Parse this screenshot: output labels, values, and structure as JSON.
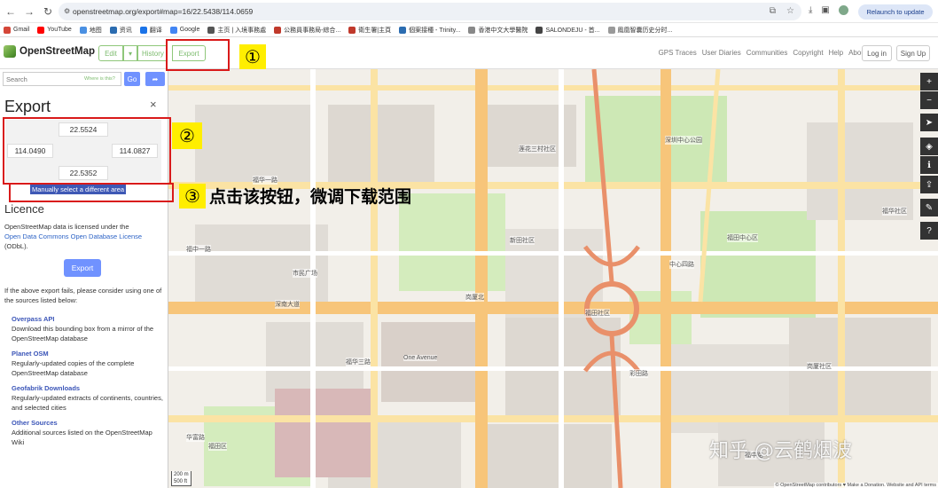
{
  "browser": {
    "url": "openstreetmap.org/export#map=16/22.5438/114.0659",
    "relaunch_label": "Relaunch to update",
    "bookmarks": [
      "Gmail",
      "YouTube",
      "地图",
      "资讯",
      "翻译",
      "Google",
      "主页 | 入境事務處",
      "公務員事務局-綜合...",
      "衛生署|主頁",
      "個案接種 - Trinity...",
      "香港中文大學醫院",
      "SALONDEJU - 首...",
      "鳳凰智囊历史分时..."
    ]
  },
  "osm": {
    "logo_text": "OpenStreetMap",
    "edit_label": "Edit",
    "edit_dropdown": "▾",
    "history_label": "History",
    "export_label": "Export",
    "nav_links": [
      "GPS Traces",
      "User Diaries",
      "Communities",
      "Copyright",
      "Help",
      "About"
    ],
    "login_label": "Log in",
    "signup_label": "Sign Up"
  },
  "search": {
    "placeholder": "Search",
    "where_is_this": "Where is this?",
    "go_label": "Go"
  },
  "export_panel": {
    "title": "Export",
    "close": "×",
    "north": "22.5524",
    "west": "114.0490",
    "east": "114.0827",
    "south": "22.5352",
    "manual_select": "Manually select a different area",
    "license_heading": "Licence",
    "license_text_1": "OpenStreetMap data is licensed under the",
    "license_link": "Open Data Commons Open Database License",
    "license_text_2": "(ODbL).",
    "export_button": "Export",
    "fail_text": "If the above export fails, please consider using one of the sources listed below:",
    "sources": [
      {
        "title": "Overpass API",
        "desc": "Download this bounding box from a mirror of the OpenStreetMap database"
      },
      {
        "title": "Planet OSM",
        "desc": "Regularly-updated copies of the complete OpenStreetMap database"
      },
      {
        "title": "Geofabrik Downloads",
        "desc": "Regularly-updated extracts of continents, countries, and selected cities"
      },
      {
        "title": "Other Sources",
        "desc": "Additional sources listed on the OpenStreetMap Wiki"
      }
    ]
  },
  "map": {
    "labels": [
      "福华一路",
      "福中一路",
      "深圳中心公园",
      "莲花三村社区",
      "新田社区",
      "福田中心区",
      "市民广场",
      "福华三路",
      "深南大道",
      "One Avenue",
      "岗厦北",
      "福田社区",
      "华富路",
      "福华社区",
      "岗厦社区",
      "彩田路",
      "中心四路",
      "福中路",
      "福田区"
    ],
    "scale_m": "200 m",
    "scale_ft": "500 ft",
    "attribution": "© OpenStreetMap contributors ♥ Make a Donation. Website and API terms"
  },
  "annotations": {
    "step1": "①",
    "step2": "②",
    "step3": "③",
    "note": "点击该按钮，微调下载范围",
    "watermark": "知乎 @云鹤烟波"
  }
}
